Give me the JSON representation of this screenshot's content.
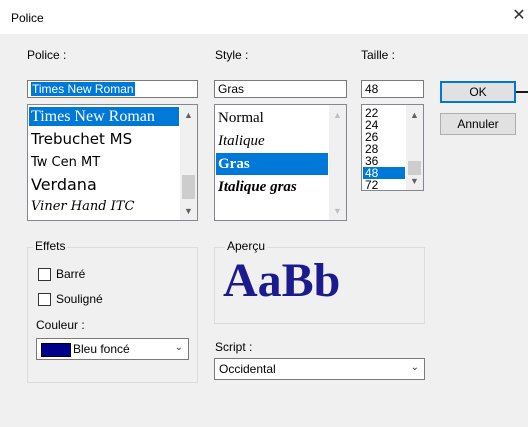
{
  "window": {
    "title": "Police",
    "close_glyph": "✕"
  },
  "font": {
    "label": "Police :",
    "value": "Times New Roman",
    "items": [
      "Times New Roman",
      "Trebuchet MS",
      "Tw Cen MT",
      "Verdana",
      "Viner Hand ITC"
    ],
    "selected": "Times New Roman"
  },
  "style": {
    "label": "Style :",
    "value": "Gras",
    "items": [
      "Normal",
      "Italique",
      "Gras",
      "Italique gras"
    ],
    "selected": "Gras"
  },
  "size": {
    "label": "Taille :",
    "value": "48",
    "items": [
      "22",
      "24",
      "26",
      "28",
      "36",
      "48",
      "72"
    ],
    "selected": "48"
  },
  "buttons": {
    "ok": "OK",
    "cancel": "Annuler"
  },
  "effects": {
    "label": "Effets",
    "strikeout": {
      "label": "Barré",
      "checked": false
    },
    "underline": {
      "label": "Souligné",
      "checked": false
    },
    "color_label": "Couleur :",
    "color_value": "Bleu foncé",
    "color_swatch": "#00008b"
  },
  "preview": {
    "label": "Aperçu",
    "sample": "AaBb",
    "color": "#1b1b8f"
  },
  "script": {
    "label": "Script :",
    "value": "Occidental"
  },
  "colors": {
    "selection": "#0078d7",
    "default_button_border": "#0078d7"
  }
}
